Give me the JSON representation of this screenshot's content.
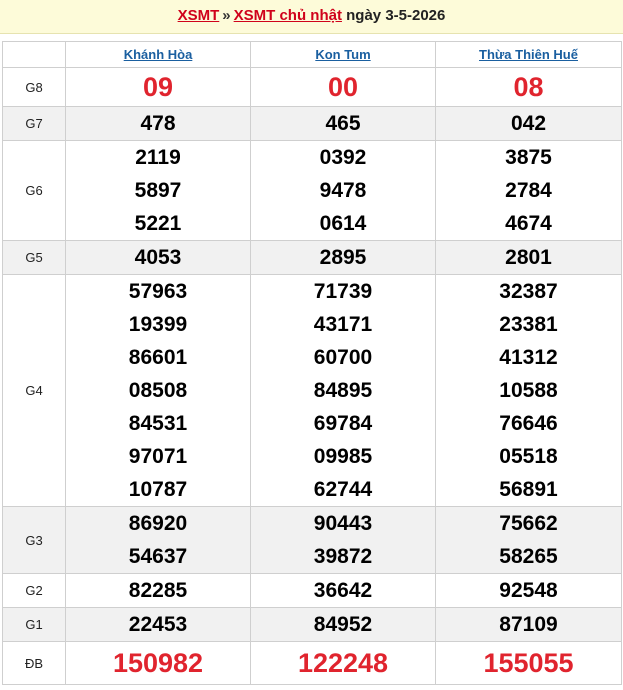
{
  "header": {
    "link1": "XSMT",
    "separator": "»",
    "link2": "XSMT chủ nhật",
    "date_text": "ngày 3-5-2026"
  },
  "provinces": [
    "Khánh Hòa",
    "Kon Tum",
    "Thừa Thiên Huế"
  ],
  "results": [
    {
      "label": "G8",
      "alt": false,
      "class": "g8",
      "red": true,
      "values": [
        [
          "09"
        ],
        [
          "00"
        ],
        [
          "08"
        ]
      ]
    },
    {
      "label": "G7",
      "alt": true,
      "class": "",
      "red": false,
      "values": [
        [
          "478"
        ],
        [
          "465"
        ],
        [
          "042"
        ]
      ]
    },
    {
      "label": "G6",
      "alt": false,
      "class": "",
      "red": false,
      "values": [
        [
          "2119",
          "5897",
          "5221"
        ],
        [
          "0392",
          "9478",
          "0614"
        ],
        [
          "3875",
          "2784",
          "4674"
        ]
      ]
    },
    {
      "label": "G5",
      "alt": true,
      "class": "",
      "red": false,
      "values": [
        [
          "4053"
        ],
        [
          "2895"
        ],
        [
          "2801"
        ]
      ]
    },
    {
      "label": "G4",
      "alt": false,
      "class": "",
      "red": false,
      "values": [
        [
          "57963",
          "19399",
          "86601",
          "08508",
          "84531",
          "97071",
          "10787"
        ],
        [
          "71739",
          "43171",
          "60700",
          "84895",
          "69784",
          "09985",
          "62744"
        ],
        [
          "32387",
          "23381",
          "41312",
          "10588",
          "76646",
          "05518",
          "56891"
        ]
      ]
    },
    {
      "label": "G3",
      "alt": true,
      "class": "",
      "red": false,
      "values": [
        [
          "86920",
          "54637"
        ],
        [
          "90443",
          "39872"
        ],
        [
          "75662",
          "58265"
        ]
      ]
    },
    {
      "label": "G2",
      "alt": false,
      "class": "",
      "red": false,
      "values": [
        [
          "82285"
        ],
        [
          "36642"
        ],
        [
          "92548"
        ]
      ]
    },
    {
      "label": "G1",
      "alt": true,
      "class": "",
      "red": false,
      "values": [
        [
          "22453"
        ],
        [
          "84952"
        ],
        [
          "87109"
        ]
      ]
    },
    {
      "label": "ĐB",
      "alt": false,
      "class": "db",
      "red": true,
      "values": [
        [
          "150982"
        ],
        [
          "122248"
        ],
        [
          "155055"
        ]
      ]
    }
  ]
}
